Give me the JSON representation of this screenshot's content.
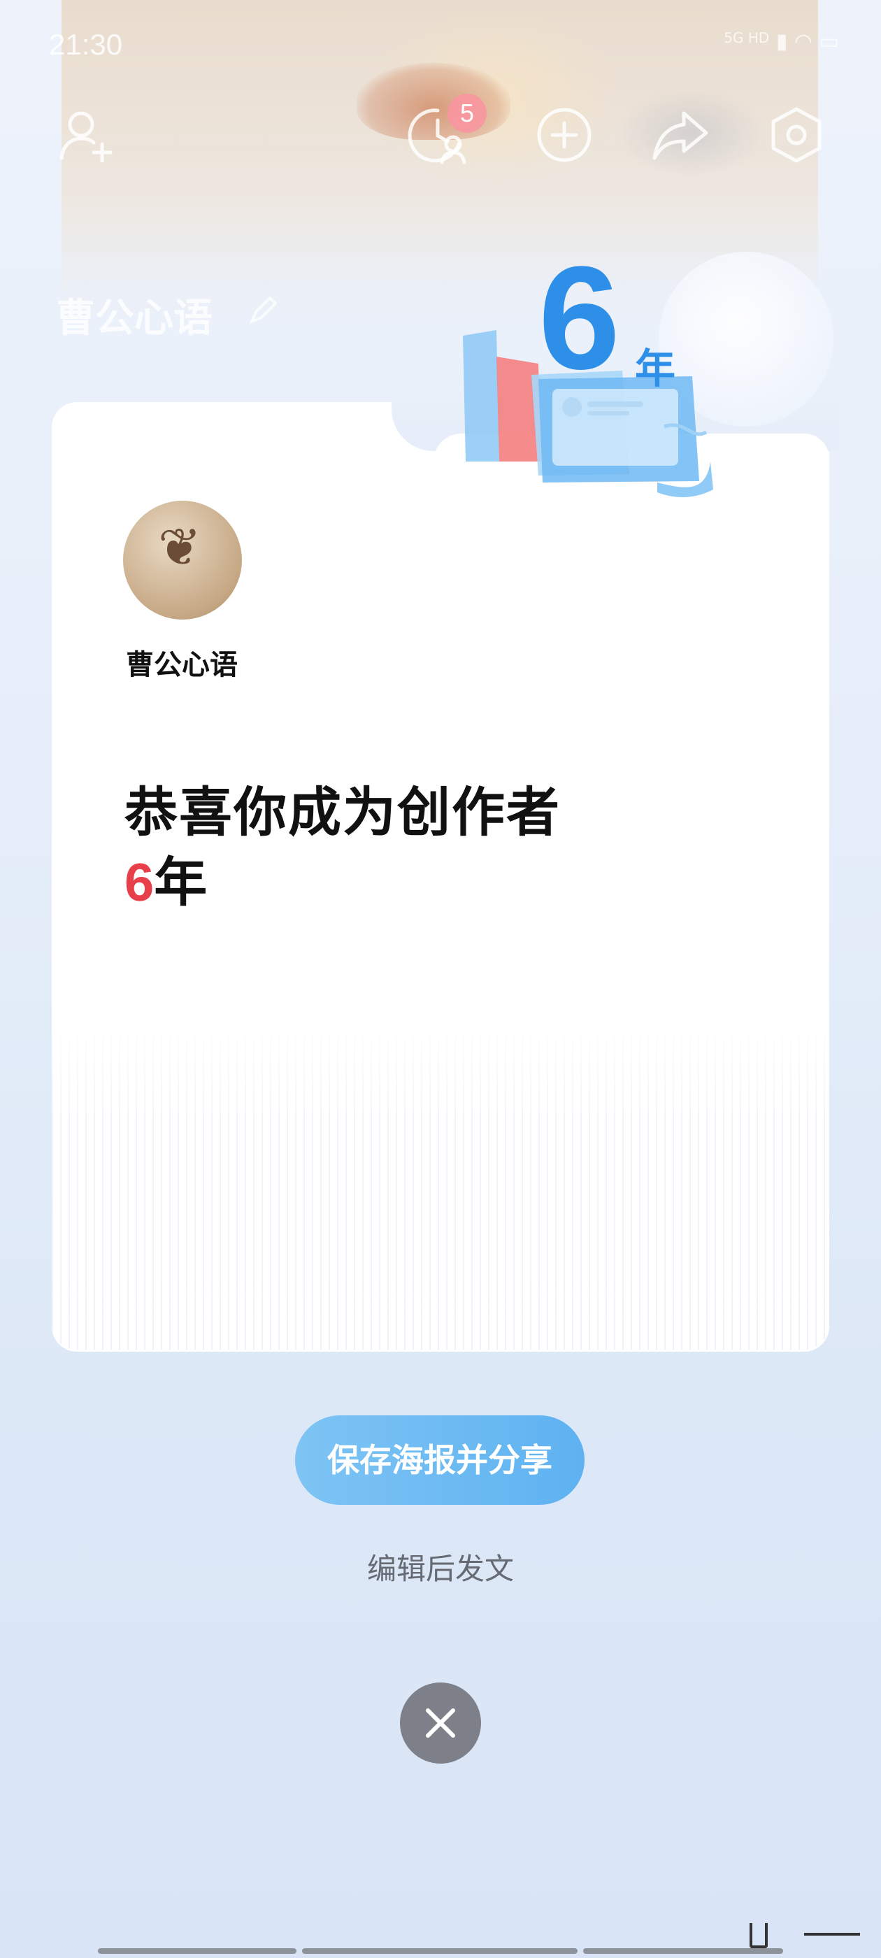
{
  "status_bar": {
    "time": "21:30",
    "network": "5G HD"
  },
  "profile_header": {
    "username": "曹公心语",
    "history_badge_count": "5",
    "icons": [
      "add-friend-icon",
      "history-icon",
      "plus-icon",
      "share-icon",
      "settings-icon"
    ]
  },
  "years_badge": {
    "number": "6",
    "unit": "年"
  },
  "card": {
    "username": "曹公心语",
    "congrats_text": "恭喜你成为创作者",
    "years_number": "6",
    "years_unit": "年"
  },
  "actions": {
    "share_label": "保存海报并分享",
    "edit_label": "编辑后发文"
  },
  "colors": {
    "accent_blue": "#5eb2f1",
    "highlight_red": "#e8404a",
    "close_gray": "#7d8088"
  }
}
